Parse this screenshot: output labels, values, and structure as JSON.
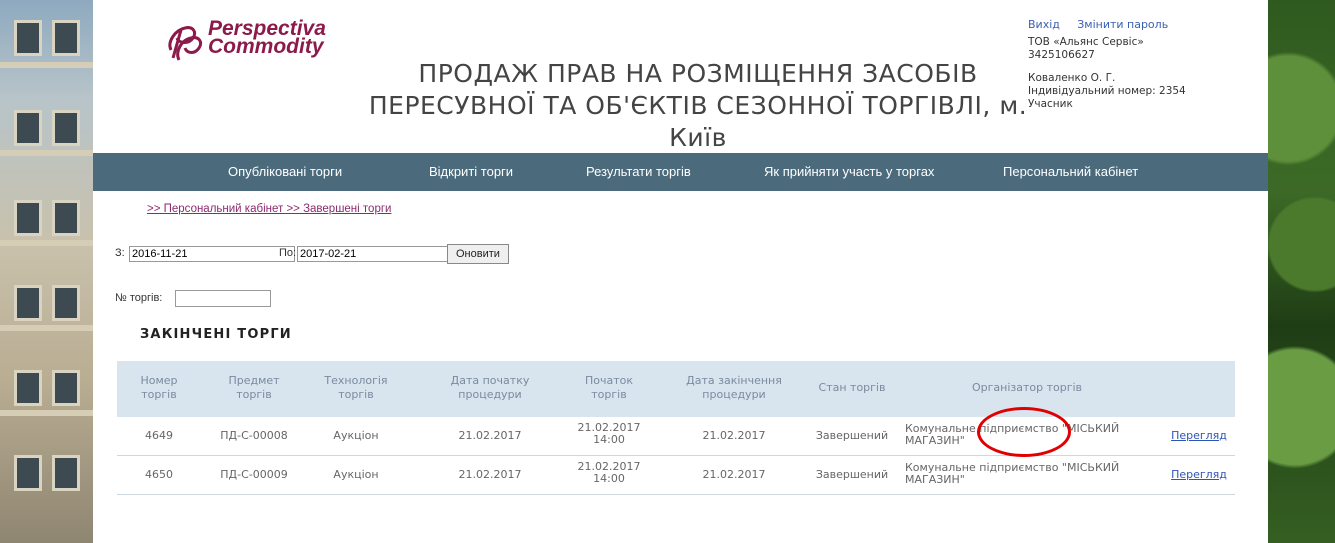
{
  "header": {
    "logo_line1": "Perspectiva",
    "logo_line2": "Commodity",
    "title": "ПРОДАЖ ПРАВ НА РОЗМІЩЕННЯ ЗАСОБІВ ПЕРЕСУВНОЇ ТА ОБ'ЄКТІВ СЕЗОННОЇ ТОРГІВЛІ, м. Київ"
  },
  "user": {
    "logout": "Вихід",
    "change_password": "Змінити пароль",
    "company": "ТОВ «Альянс Сервіс»",
    "company_code": "3425106627",
    "person": "Коваленко О. Г.",
    "individual_number": "Індивідуальний номер: 2354",
    "role": "Учасник"
  },
  "nav": {
    "items": [
      "Опубліковані торги",
      "Відкриті торги",
      "Результати торгів",
      "Як прийняти участь у торгах",
      "Персональний кабінет"
    ]
  },
  "breadcrumb": ">> Персональний кабінет >> Завершені торги",
  "filters": {
    "from_label": "З:",
    "from_value": "2016-11-21",
    "to_label": "По:",
    "to_value": "2017-02-21",
    "refresh_label": "Оновити",
    "number_label": "№ торгів:",
    "number_value": ""
  },
  "section_title": "ЗАКІНЧЕНІ ТОРГИ",
  "table": {
    "headers": [
      [
        "Номер",
        "торгів"
      ],
      [
        "Предмет",
        "торгів"
      ],
      [
        "Технологія",
        "торгів"
      ],
      [
        "Дата початку",
        "процедури"
      ],
      [
        "Початок",
        "торгів"
      ],
      [
        "Дата закінчення",
        "процедури"
      ],
      [
        "Стан торгів",
        ""
      ],
      [
        "Організатор торгів",
        ""
      ]
    ],
    "rows": [
      {
        "number": "4649",
        "subject": "ПД-С-00008",
        "technology": "Аукціон",
        "start_date": "21.02.2017",
        "start_time_date": "21.02.2017",
        "start_time_hour": "14:00",
        "end_date": "21.02.2017",
        "status": "Завершений",
        "organizer": "Комунальне підприємство \"МІСЬКИЙ МАГАЗИН\"",
        "action": "Перегляд"
      },
      {
        "number": "4650",
        "subject": "ПД-С-00009",
        "technology": "Аукціон",
        "start_date": "21.02.2017",
        "start_time_date": "21.02.2017",
        "start_time_hour": "14:00",
        "end_date": "21.02.2017",
        "status": "Завершений",
        "organizer": "Комунальне підприємство \"МІСЬКИЙ МАГАЗИН\"",
        "action": "Перегляд"
      }
    ]
  },
  "colors": {
    "nav_bg": "#4b6b7c",
    "table_header_bg": "#d8e4ee",
    "brand": "#8c1a4a",
    "link": "#2d55b5",
    "highlight": "#e00000"
  }
}
